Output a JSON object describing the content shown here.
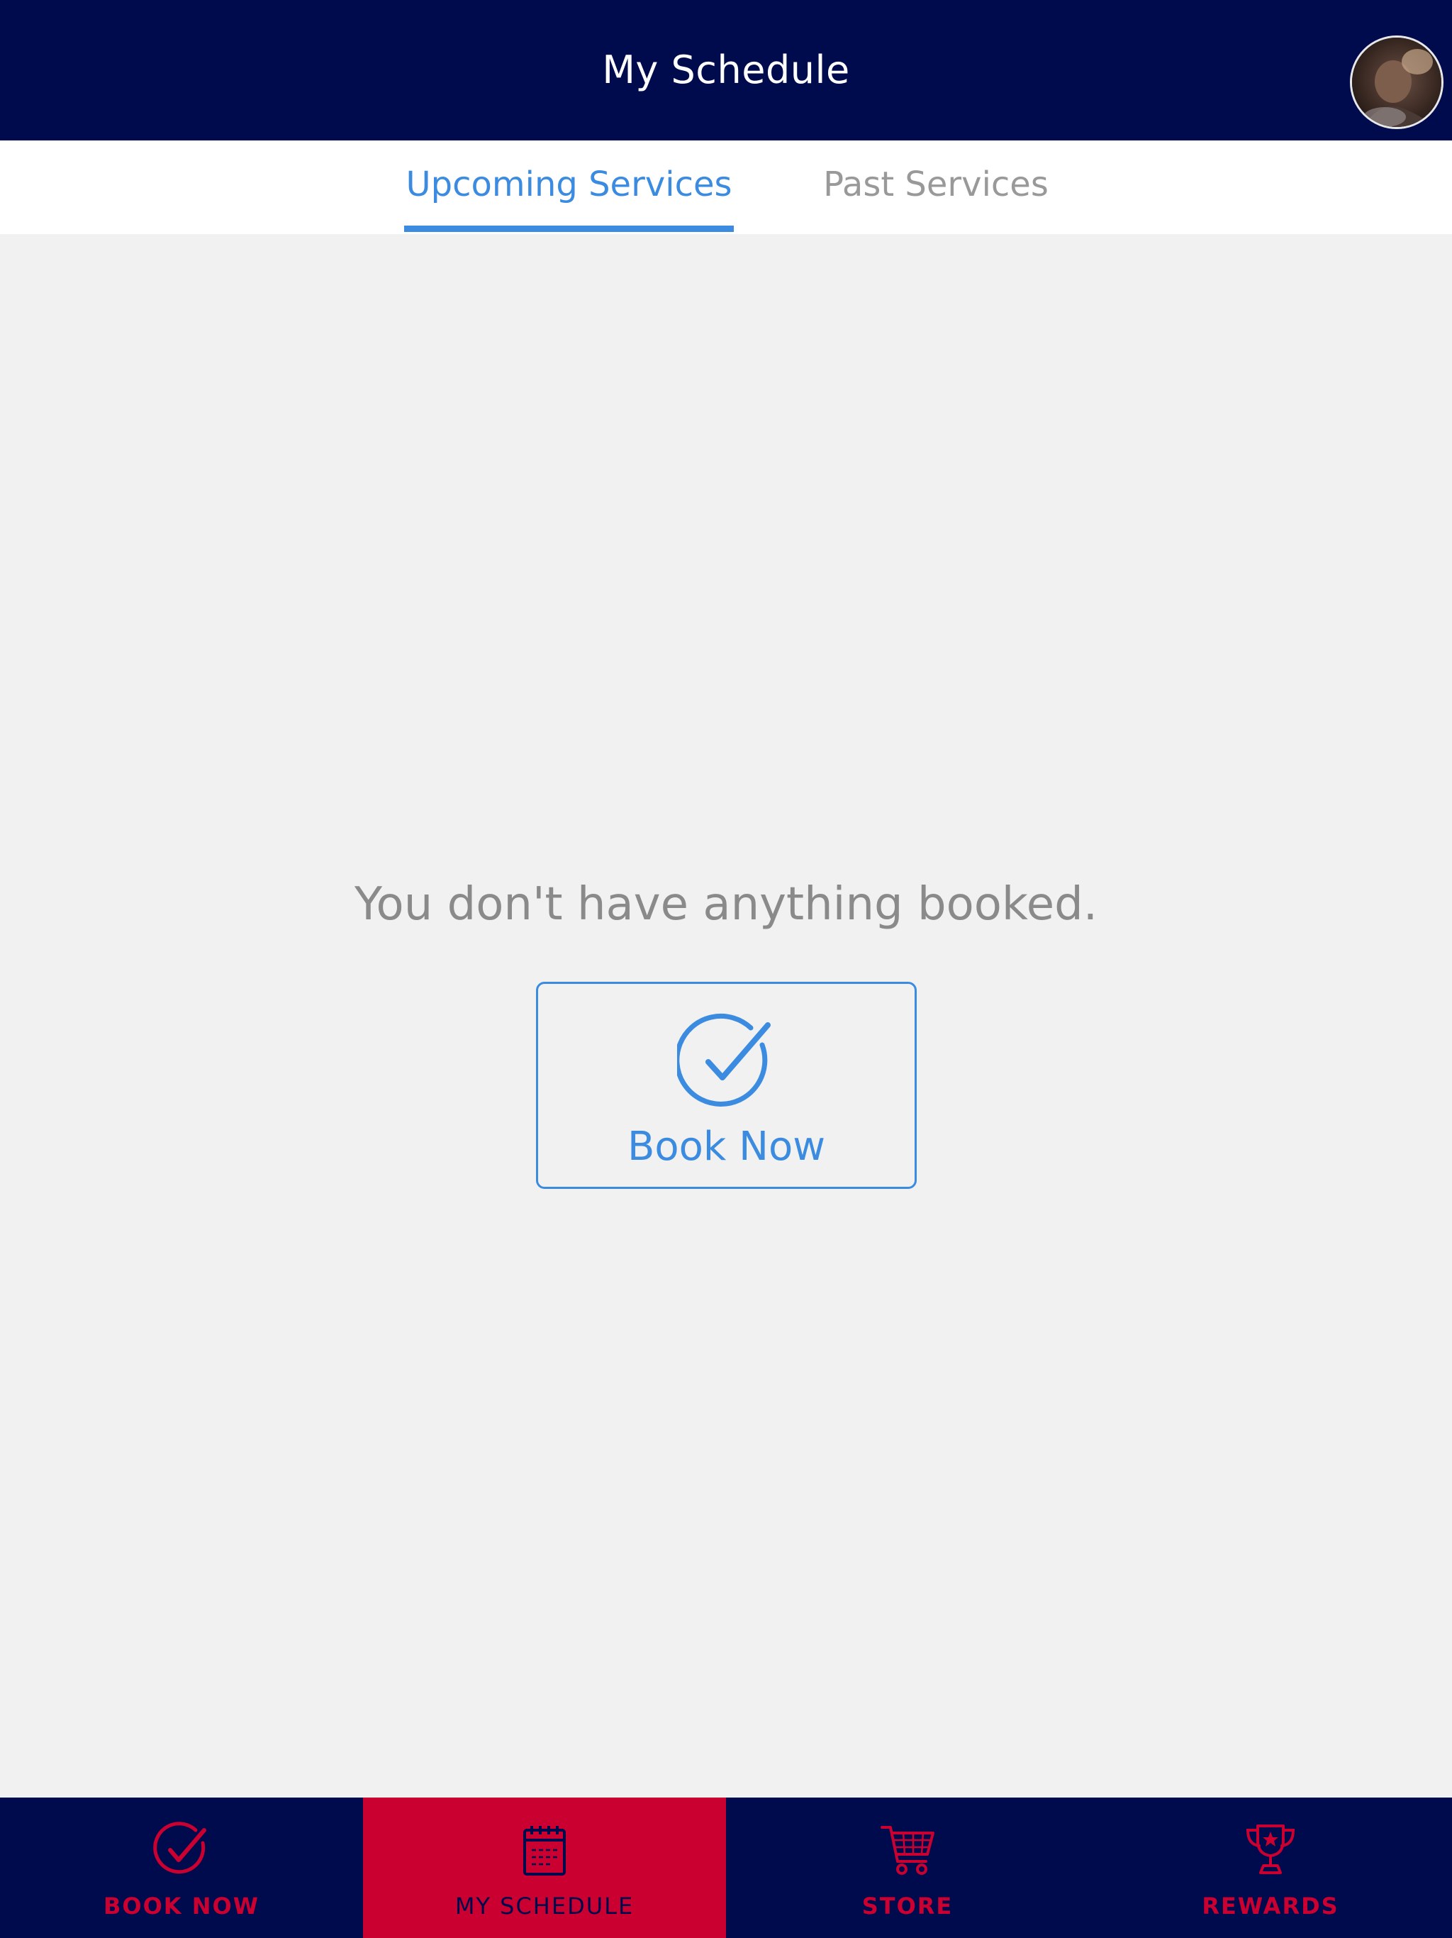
{
  "header": {
    "title": "My Schedule",
    "avatar_icon": "user-avatar"
  },
  "tabs": [
    {
      "label": "Upcoming Services",
      "active": true
    },
    {
      "label": "Past Services",
      "active": false
    }
  ],
  "empty_state": {
    "message": "You don't have anything booked.",
    "button_label": "Book Now",
    "button_icon": "check-circle-icon"
  },
  "bottom_nav": [
    {
      "label": "BOOK NOW",
      "icon": "check-circle-icon",
      "active": false
    },
    {
      "label": "MY SCHEDULE",
      "icon": "calendar-icon",
      "active": true
    },
    {
      "label": "STORE",
      "icon": "cart-icon",
      "active": false
    },
    {
      "label": "REWARDS",
      "icon": "trophy-icon",
      "active": false
    }
  ],
  "colors": {
    "header_bg": "#000b4d",
    "accent_blue": "#3b8be0",
    "accent_red": "#c90030",
    "page_bg": "#f1f1f1"
  }
}
